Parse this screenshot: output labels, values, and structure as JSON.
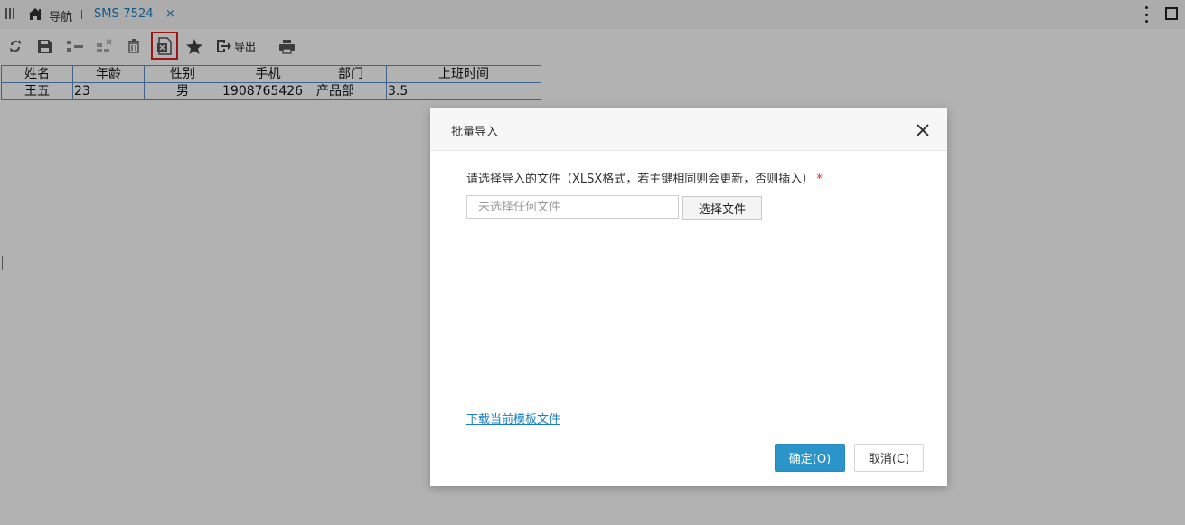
{
  "tabbar": {
    "home_label": "导航",
    "active_tab_label": "SMS-7524",
    "close_glyph": "×"
  },
  "toolbar": {
    "icons": [
      "refresh-icon",
      "save-icon",
      "add-rows-icon",
      "delete-rows-icon",
      "trash-icon",
      "excel-import-icon",
      "star-icon",
      "export-icon",
      "print-icon"
    ],
    "export_label": "导出",
    "highlight_color": "#e02020"
  },
  "table": {
    "headers": [
      "姓名",
      "年龄",
      "性别",
      "手机",
      "部门",
      "上班时间"
    ],
    "rows": [
      [
        "王五",
        "23",
        "男",
        "1908765426",
        "产品部",
        "3.5"
      ]
    ]
  },
  "dialog": {
    "title": "批量导入",
    "prompt": "请选择导入的文件（XLSX格式，若主键相同则会更新，否则插入）",
    "required_mark": "*",
    "file_placeholder": "未选择任何文件",
    "choose_file_label": "选择文件",
    "template_link": "下载当前模板文件",
    "ok_label": "确定(O)",
    "cancel_label": "取消(C)",
    "ok_color": "#2b95c9"
  }
}
